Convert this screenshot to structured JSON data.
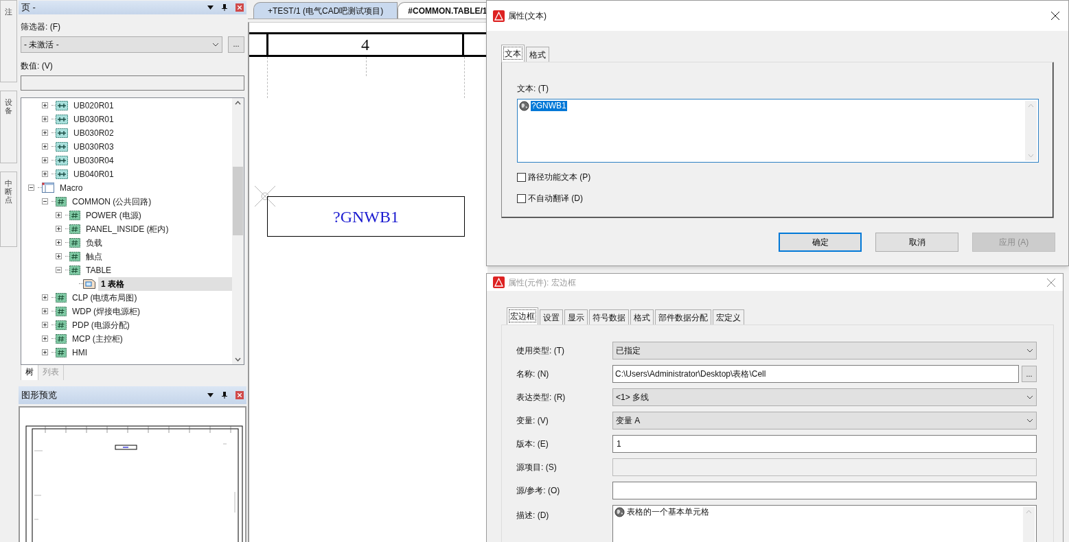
{
  "side_tabs": [
    {
      "label": "注"
    },
    {
      "label": "设备"
    },
    {
      "label": "中断点"
    }
  ],
  "page_panel": {
    "title": "页 -",
    "filter_label": "筛选器: (F)",
    "filter_value": "- 未激活 -",
    "browse_button": "...",
    "value_label": "数值: (V)",
    "tree": {
      "continued_children": [
        {
          "label": "UB020R01",
          "kind": "macro",
          "expanded": false
        },
        {
          "label": "UB030R01",
          "kind": "macro",
          "expanded": false
        },
        {
          "label": "UB030R02",
          "kind": "macro",
          "expanded": false
        },
        {
          "label": "UB030R03",
          "kind": "macro",
          "expanded": false
        },
        {
          "label": "UB030R04",
          "kind": "macro",
          "expanded": false
        },
        {
          "label": "UB040R01",
          "kind": "macro",
          "expanded": false
        }
      ],
      "items": [
        {
          "label": "Macro",
          "kind": "project",
          "expanded": true,
          "children": [
            {
              "label": "COMMON (公共回路)",
              "kind": "group",
              "expanded": true,
              "children": [
                {
                  "label": "POWER (电源)",
                  "kind": "group",
                  "expanded": false
                },
                {
                  "label": "PANEL_INSIDE (柜内)",
                  "kind": "group",
                  "expanded": false
                },
                {
                  "label": "负载",
                  "kind": "group",
                  "expanded": false
                },
                {
                  "label": "触点",
                  "kind": "group",
                  "expanded": false
                },
                {
                  "label": "TABLE",
                  "kind": "group",
                  "expanded": true,
                  "children": [
                    {
                      "label": "1 表格",
                      "kind": "page",
                      "selected": true
                    }
                  ]
                }
              ]
            },
            {
              "label": "CLP (电缆布局图)",
              "kind": "group",
              "expanded": false
            },
            {
              "label": "WDP (焊接电源柜)",
              "kind": "group",
              "expanded": false
            },
            {
              "label": "PDP (电源分配)",
              "kind": "group",
              "expanded": false
            },
            {
              "label": "MCP (主控柜)",
              "kind": "group",
              "expanded": false
            },
            {
              "label": "HMI",
              "kind": "group",
              "expanded": false
            }
          ]
        }
      ]
    },
    "bottom_tabs": [
      {
        "label": "树",
        "selected": true
      },
      {
        "label": "列表",
        "selected": false
      }
    ]
  },
  "preview_panel": {
    "title": "图形预览"
  },
  "editor": {
    "tabs": [
      {
        "label": "+TEST/1 (电气CAD吧测试项目)",
        "selected": false
      },
      {
        "label": "#COMMON.TABLE/1",
        "selected": true
      }
    ],
    "column_number": "4",
    "cell_text": "?GNWB1"
  },
  "text_dialog": {
    "title": "属性(文本)",
    "tabs": [
      {
        "label": "文本",
        "selected": true
      },
      {
        "label": "格式",
        "selected": false
      }
    ],
    "text_label": "文本: (T)",
    "text_value": "?GNWB1",
    "checkboxes": [
      {
        "label": "路径功能文本 (P)",
        "checked": false
      },
      {
        "label": "不自动翻译 (D)",
        "checked": false
      }
    ],
    "buttons": [
      {
        "label": "确定",
        "default": true,
        "disabled": false
      },
      {
        "label": "取消",
        "default": false,
        "disabled": false
      },
      {
        "label": "应用 (A)",
        "default": false,
        "disabled": true
      }
    ]
  },
  "component_dialog": {
    "title": "属性(元件): 宏边框",
    "tabs": [
      {
        "label": "宏边框",
        "selected": true
      },
      {
        "label": "设置",
        "selected": false
      },
      {
        "label": "显示",
        "selected": false
      },
      {
        "label": "符号数据",
        "selected": false
      },
      {
        "label": "格式",
        "selected": false
      },
      {
        "label": "部件数据分配",
        "selected": false
      },
      {
        "label": "宏定义",
        "selected": false
      }
    ],
    "fields": [
      {
        "label": "使用类型: (T)",
        "kind": "select",
        "value": "已指定"
      },
      {
        "label": "名称: (N)",
        "kind": "browse",
        "value": "C:\\Users\\Administrator\\Desktop\\表格\\Cell",
        "button": "..."
      },
      {
        "label": "表达类型: (R)",
        "kind": "select",
        "value": "<1> 多线"
      },
      {
        "label": "变量: (V)",
        "kind": "select",
        "value": "变量 A"
      },
      {
        "label": "版本: (E)",
        "kind": "input",
        "value": "1"
      },
      {
        "label": "源项目: (S)",
        "kind": "input",
        "disabled": true
      },
      {
        "label": "源/参考: (O)",
        "kind": "input"
      },
      {
        "label": "描述: (D)",
        "kind": "textarea",
        "value": "表格的一个基本单元格"
      }
    ]
  }
}
